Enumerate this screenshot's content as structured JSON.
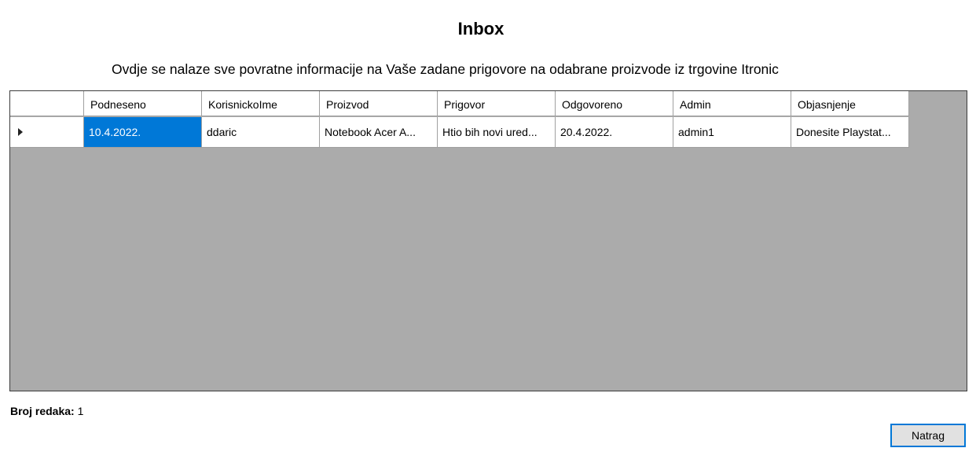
{
  "window": {
    "title": "Inbox",
    "subtitle": "Ovdje se nalaze sve povratne informacije na Vaše zadane prigovore na odabrane proizvode iz trgovine Itronic"
  },
  "grid": {
    "columns": [
      "Podneseno",
      "KorisnickoIme",
      "Proizvod",
      "Prigovor",
      "Odgovoreno",
      "Admin",
      "Objasnjenje"
    ],
    "rows": [
      {
        "selected_cell": "Podneseno",
        "cells": [
          "10.4.2022.",
          "ddaric",
          "Notebook Acer A...",
          "Htio bih novi ured...",
          "20.4.2022.",
          "admin1",
          "Donesite Playstat..."
        ]
      }
    ],
    "current_row_icon": "row-pointer-icon"
  },
  "footer": {
    "row_count_label": "Broj redaka:",
    "row_count_value": "1",
    "back_button_label": "Natrag"
  },
  "colors": {
    "selection": "#0078d7",
    "grid_background": "#ababab",
    "button_border": "#0078d7"
  }
}
